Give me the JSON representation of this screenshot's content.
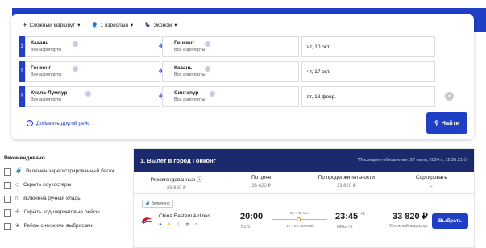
{
  "search": {
    "route_type": "Сложный маршрут",
    "passengers": "1 взрослый",
    "cabin": "Эконом",
    "legs": [
      {
        "num": "1",
        "from": "Казань",
        "from_sub": "Все аэропорты",
        "to": "Гонконг",
        "to_sub": "Все аэропорты",
        "date": "чт, 10 окт."
      },
      {
        "num": "2",
        "from": "Гонконг",
        "from_sub": "Все аэропорты",
        "to": "Казань",
        "to_sub": "Все аэропорты",
        "date": "чт, 17 окт."
      },
      {
        "num": "3",
        "from": "Куала-Лумпур",
        "from_sub": "Все аэропорты",
        "to": "Сингапур",
        "to_sub": "Все аэропорты",
        "date": "вт, 18 февр."
      }
    ],
    "add_route": "Добавить другой рейс",
    "find_button": "Найти"
  },
  "sidebar": {
    "title": "Рекомендовано",
    "filters": [
      "Включен зарегистрированный багаж",
      "Скрыть лоукостеры",
      "Включена ручная кладь",
      "Скрыть код-шеринговые рейсы",
      "Рейсы с низкими выбросами"
    ]
  },
  "results": {
    "title": "1. Вылет в город Гонконг",
    "updated": "*Последнее обновление: 27 июля, 2024 г., 12:26:21",
    "tabs": [
      {
        "label": "Рекомендованные ⓘ",
        "price": "33 820 ₽"
      },
      {
        "label": "По цене",
        "price": "33 820 ₽"
      },
      {
        "label": "По продолжительности",
        "price": "33 820 ₽"
      },
      {
        "label": "Сортировать",
        "price": "⌄"
      }
    ],
    "flight": {
      "badge": "Включено",
      "airline": "China Eastern Airlines",
      "amenities": "✈ ⚡ 🍴 ☕ ▭",
      "dep_time": "20:00",
      "dep_code": "KZN",
      "duration": "22 ч 45 мин",
      "stop": "12 ч в г. Шанхай",
      "arr_time": "23:45",
      "arr_plus": "+1",
      "arr_code": "HKG T1",
      "price": "33 820 ₽",
      "price_sub": "Сложный маршрут",
      "select": "Выбрать"
    }
  },
  "colors": {
    "accent": "#1f3fc4",
    "header": "#1a2a6c"
  }
}
